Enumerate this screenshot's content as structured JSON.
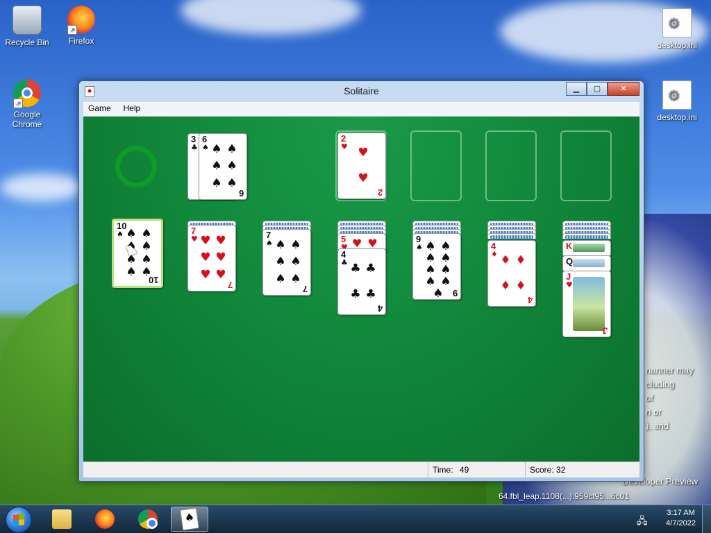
{
  "desktop": {
    "icons": [
      {
        "label": "Recycle Bin"
      },
      {
        "label": "Firefox"
      },
      {
        "label": "Google Chrome"
      },
      {
        "label": "desktop.ini"
      },
      {
        "label": "desktop.ini"
      }
    ],
    "background_text": {
      "line1": "nanner may",
      "line2": "cluding",
      "line3": "of",
      "line4": "n or",
      "line5": "), and",
      "line6": "Developer Preview",
      "line7": "64.fbl_leap.1108(...).959cf95...6c01"
    }
  },
  "window": {
    "title": "Solitaire",
    "controls": {
      "minimize": "▁",
      "maximize": "▢",
      "close": "✕"
    },
    "menu": {
      "game": "Game",
      "help": "Help"
    },
    "status": {
      "time_label": "Time:",
      "time_value": "49",
      "score_label": "Score:",
      "score_value": "32"
    }
  },
  "game": {
    "waste": {
      "top_card": {
        "rank": "6",
        "suit": "♠",
        "color": "black"
      },
      "under_card": {
        "rank": "3",
        "suit": "♣"
      }
    },
    "foundations": [
      {
        "rank": "2",
        "suit": "♥",
        "color": "red"
      },
      {
        "empty": true
      },
      {
        "empty": true
      },
      {
        "empty": true
      }
    ],
    "tableau": [
      {
        "facedown": 0,
        "cards": [
          {
            "rank": "10",
            "suit": "♠"
          }
        ]
      },
      {
        "facedown": 1,
        "cards": [
          {
            "rank": "7",
            "suit": "♥"
          }
        ]
      },
      {
        "facedown": 2,
        "cards": [
          {
            "rank": "7",
            "suit": "♠"
          }
        ]
      },
      {
        "facedown": 3,
        "cards": [
          {
            "rank": "5",
            "suit": "♥"
          },
          {
            "rank": "4",
            "suit": "♣"
          }
        ]
      },
      {
        "facedown": 3,
        "cards": [
          {
            "rank": "9",
            "suit": "♠"
          }
        ]
      },
      {
        "facedown": 4,
        "cards": [
          {
            "rank": "4",
            "suit": "♦"
          }
        ]
      },
      {
        "facedown": 4,
        "cards": [
          {
            "rank": "K",
            "suit": "♥"
          },
          {
            "rank": "Q",
            "suit": "♣"
          },
          {
            "rank": "J",
            "suit": "♥"
          }
        ]
      }
    ]
  },
  "taskbar": {
    "clock": {
      "time": "3:17 AM",
      "date": "4/7/2022"
    },
    "colors": {
      "accent": "#1f4f8a",
      "felt": "#128b3d"
    }
  }
}
